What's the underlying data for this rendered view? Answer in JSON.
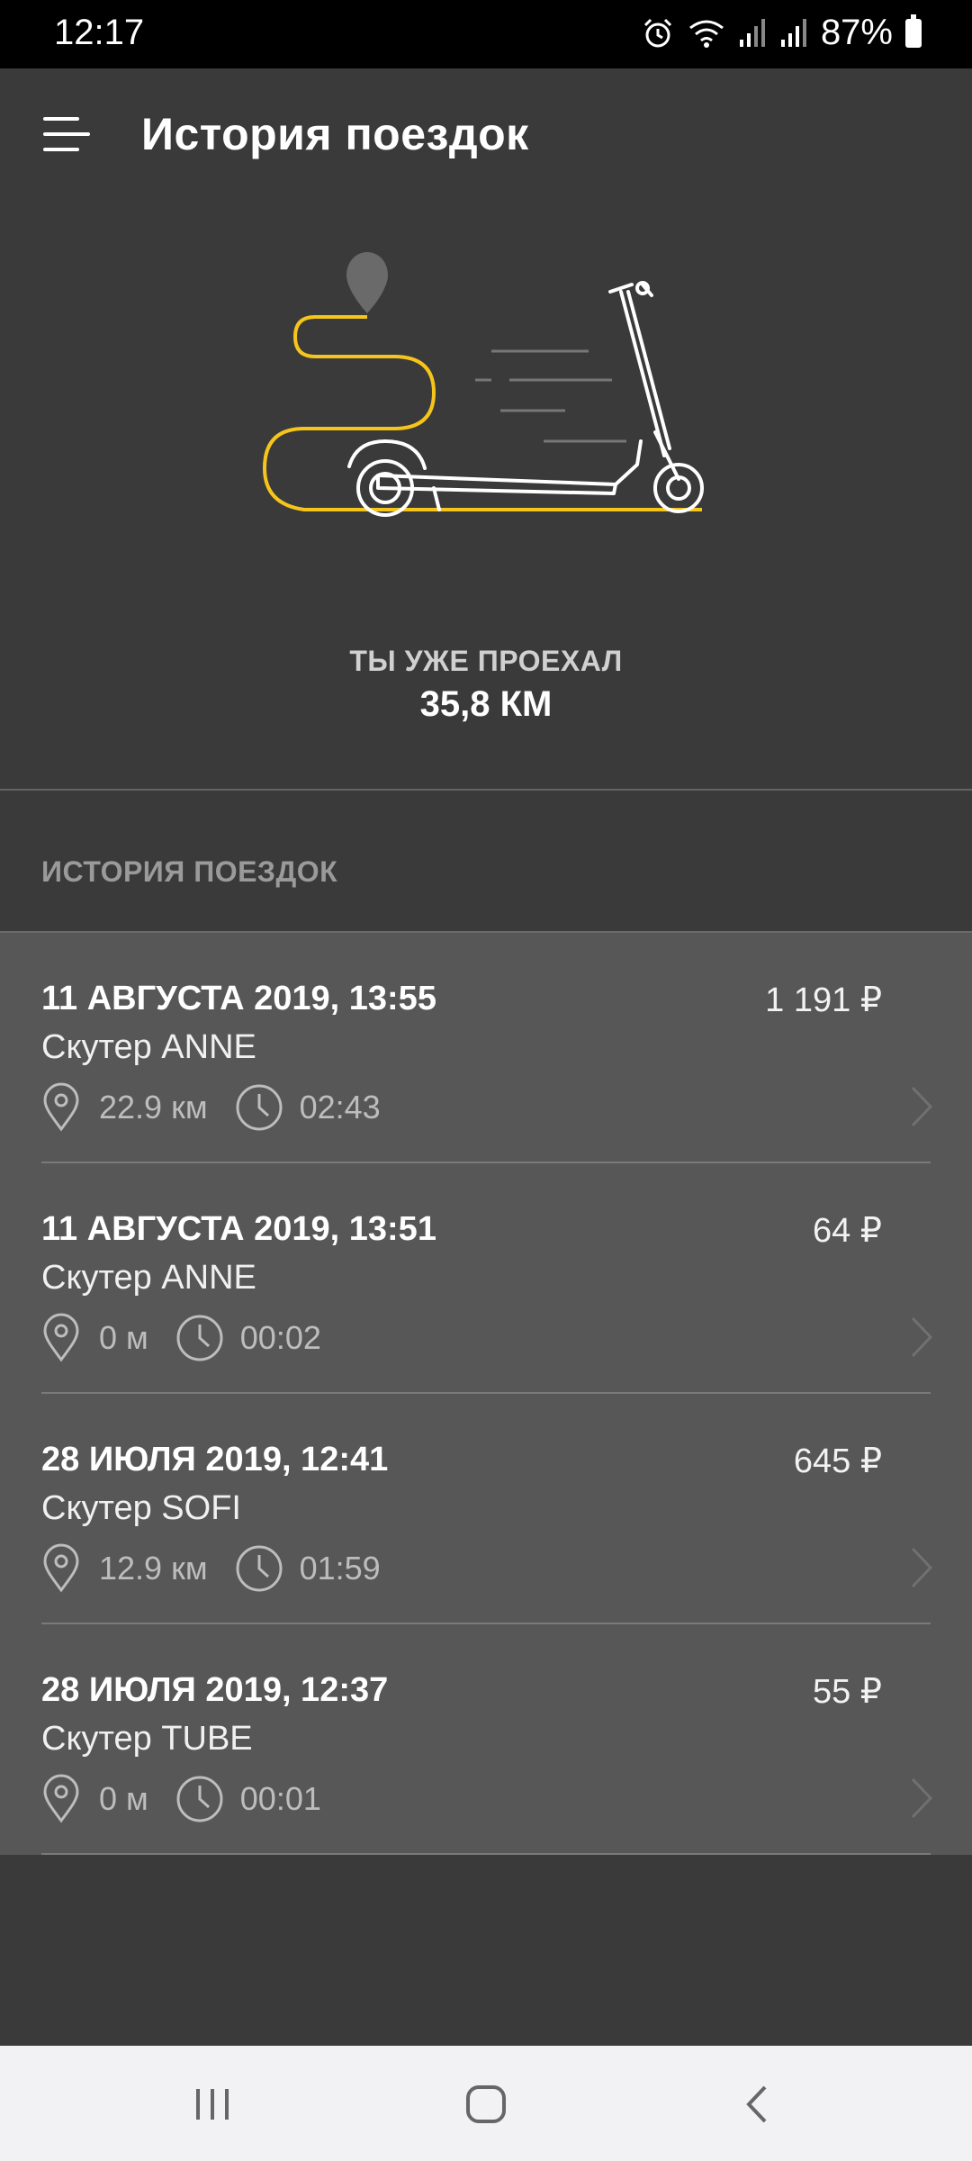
{
  "status_bar": {
    "time": "12:17",
    "battery": "87%",
    "icons": [
      "alarm-icon",
      "wifi-icon",
      "signal-icon",
      "signal-icon",
      "battery-icon"
    ]
  },
  "app_bar": {
    "title": "История поездок",
    "menu_icon": "menu-icon"
  },
  "summary": {
    "label": "ТЫ УЖЕ ПРОЕХАЛ",
    "value": "35,8 КМ"
  },
  "section_title": "ИСТОРИЯ ПОЕЗДОК",
  "rides": [
    {
      "date": "11 АВГУСТА 2019, 13:55",
      "price": "1 191 ₽",
      "scooter": "Скутер ANNE",
      "distance": "22.9 км",
      "duration": "02:43"
    },
    {
      "date": "11 АВГУСТА 2019, 13:51",
      "price": "64 ₽",
      "scooter": "Скутер ANNE",
      "distance": "0 м",
      "duration": "00:02"
    },
    {
      "date": "28 ИЮЛЯ 2019, 12:41",
      "price": "645 ₽",
      "scooter": "Скутер SOFI",
      "distance": "12.9 км",
      "duration": "01:59"
    },
    {
      "date": "28 ИЮЛЯ 2019, 12:37",
      "price": "55 ₽",
      "scooter": "Скутер TUBE",
      "distance": "0 м",
      "duration": "00:01"
    }
  ],
  "colors": {
    "background": "#3a3a3b",
    "list_background": "#575758",
    "accent_route": "#f5c51b",
    "nav_bar": "#f2f2f4"
  }
}
